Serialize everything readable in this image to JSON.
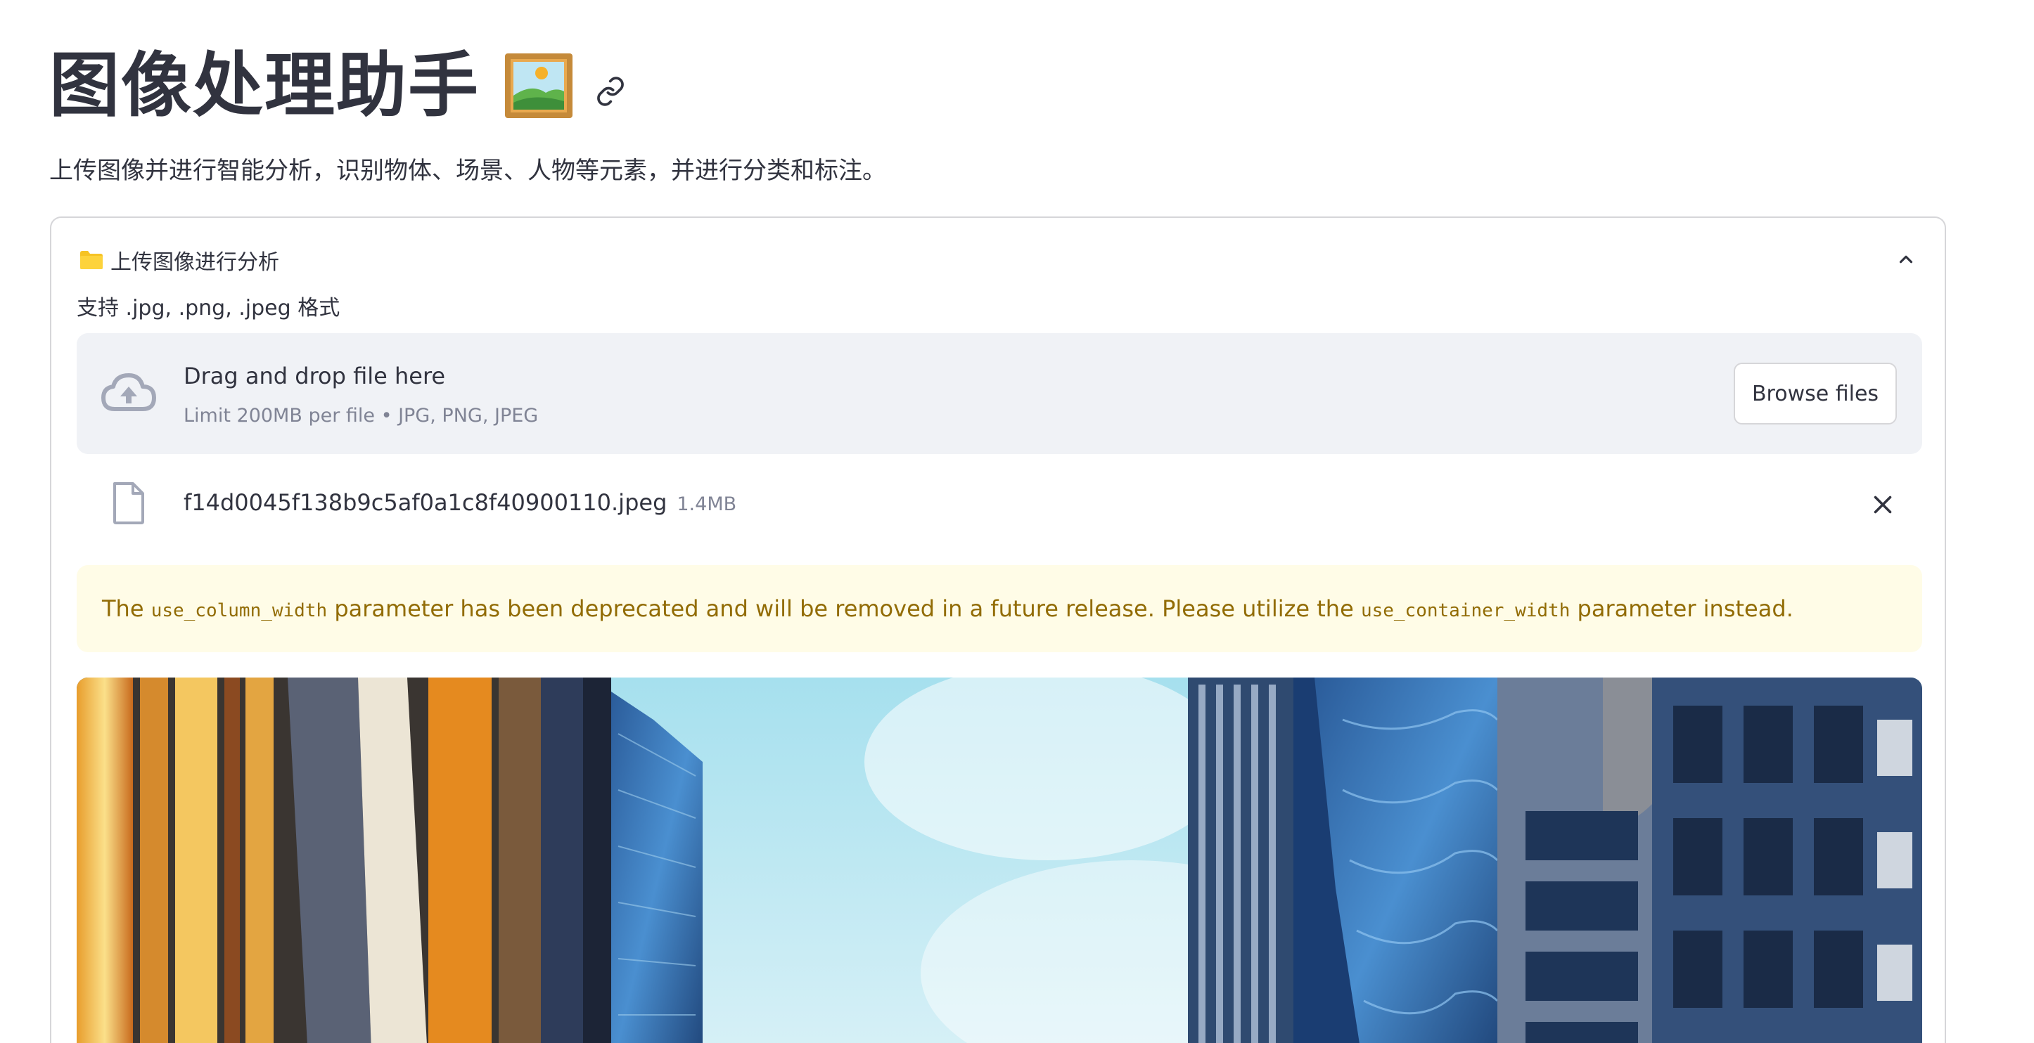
{
  "page": {
    "title": "图像处理助手",
    "title_emoji_icon": "framed-picture-icon",
    "anchor_icon": "link-icon",
    "subtitle": "上传图像并进行智能分析，识别物体、场景、人物等元素，并进行分类和标注。"
  },
  "expander": {
    "icon": "folder-icon",
    "title": "上传图像进行分析",
    "toggle_icon": "chevron-up-icon",
    "uploader": {
      "label": "支持 .jpg, .png, .jpeg 格式",
      "drop_icon": "cloud-upload-icon",
      "drop_main": "Drag and drop file here",
      "drop_sub": "Limit 200MB per file • JPG, PNG, JPEG",
      "browse_label": "Browse files"
    },
    "file": {
      "icon": "file-icon",
      "name": "f14d0045f138b9c5af0a1c8f40900110.jpeg",
      "size": "1.4MB",
      "remove_icon": "close-icon"
    },
    "warning": {
      "prefix": "The",
      "code1": "use_column_width",
      "middle": "parameter has been deprecated and will be removed in a future release. Please utilize the",
      "code2": "use_container_width",
      "suffix": "parameter instead."
    }
  },
  "colors": {
    "text": "#31333f",
    "muted": "#808495",
    "dropzone_bg": "#f0f2f6",
    "warning_bg": "#fffce7",
    "warning_text": "#926c05",
    "border": "#d6d6d9"
  }
}
